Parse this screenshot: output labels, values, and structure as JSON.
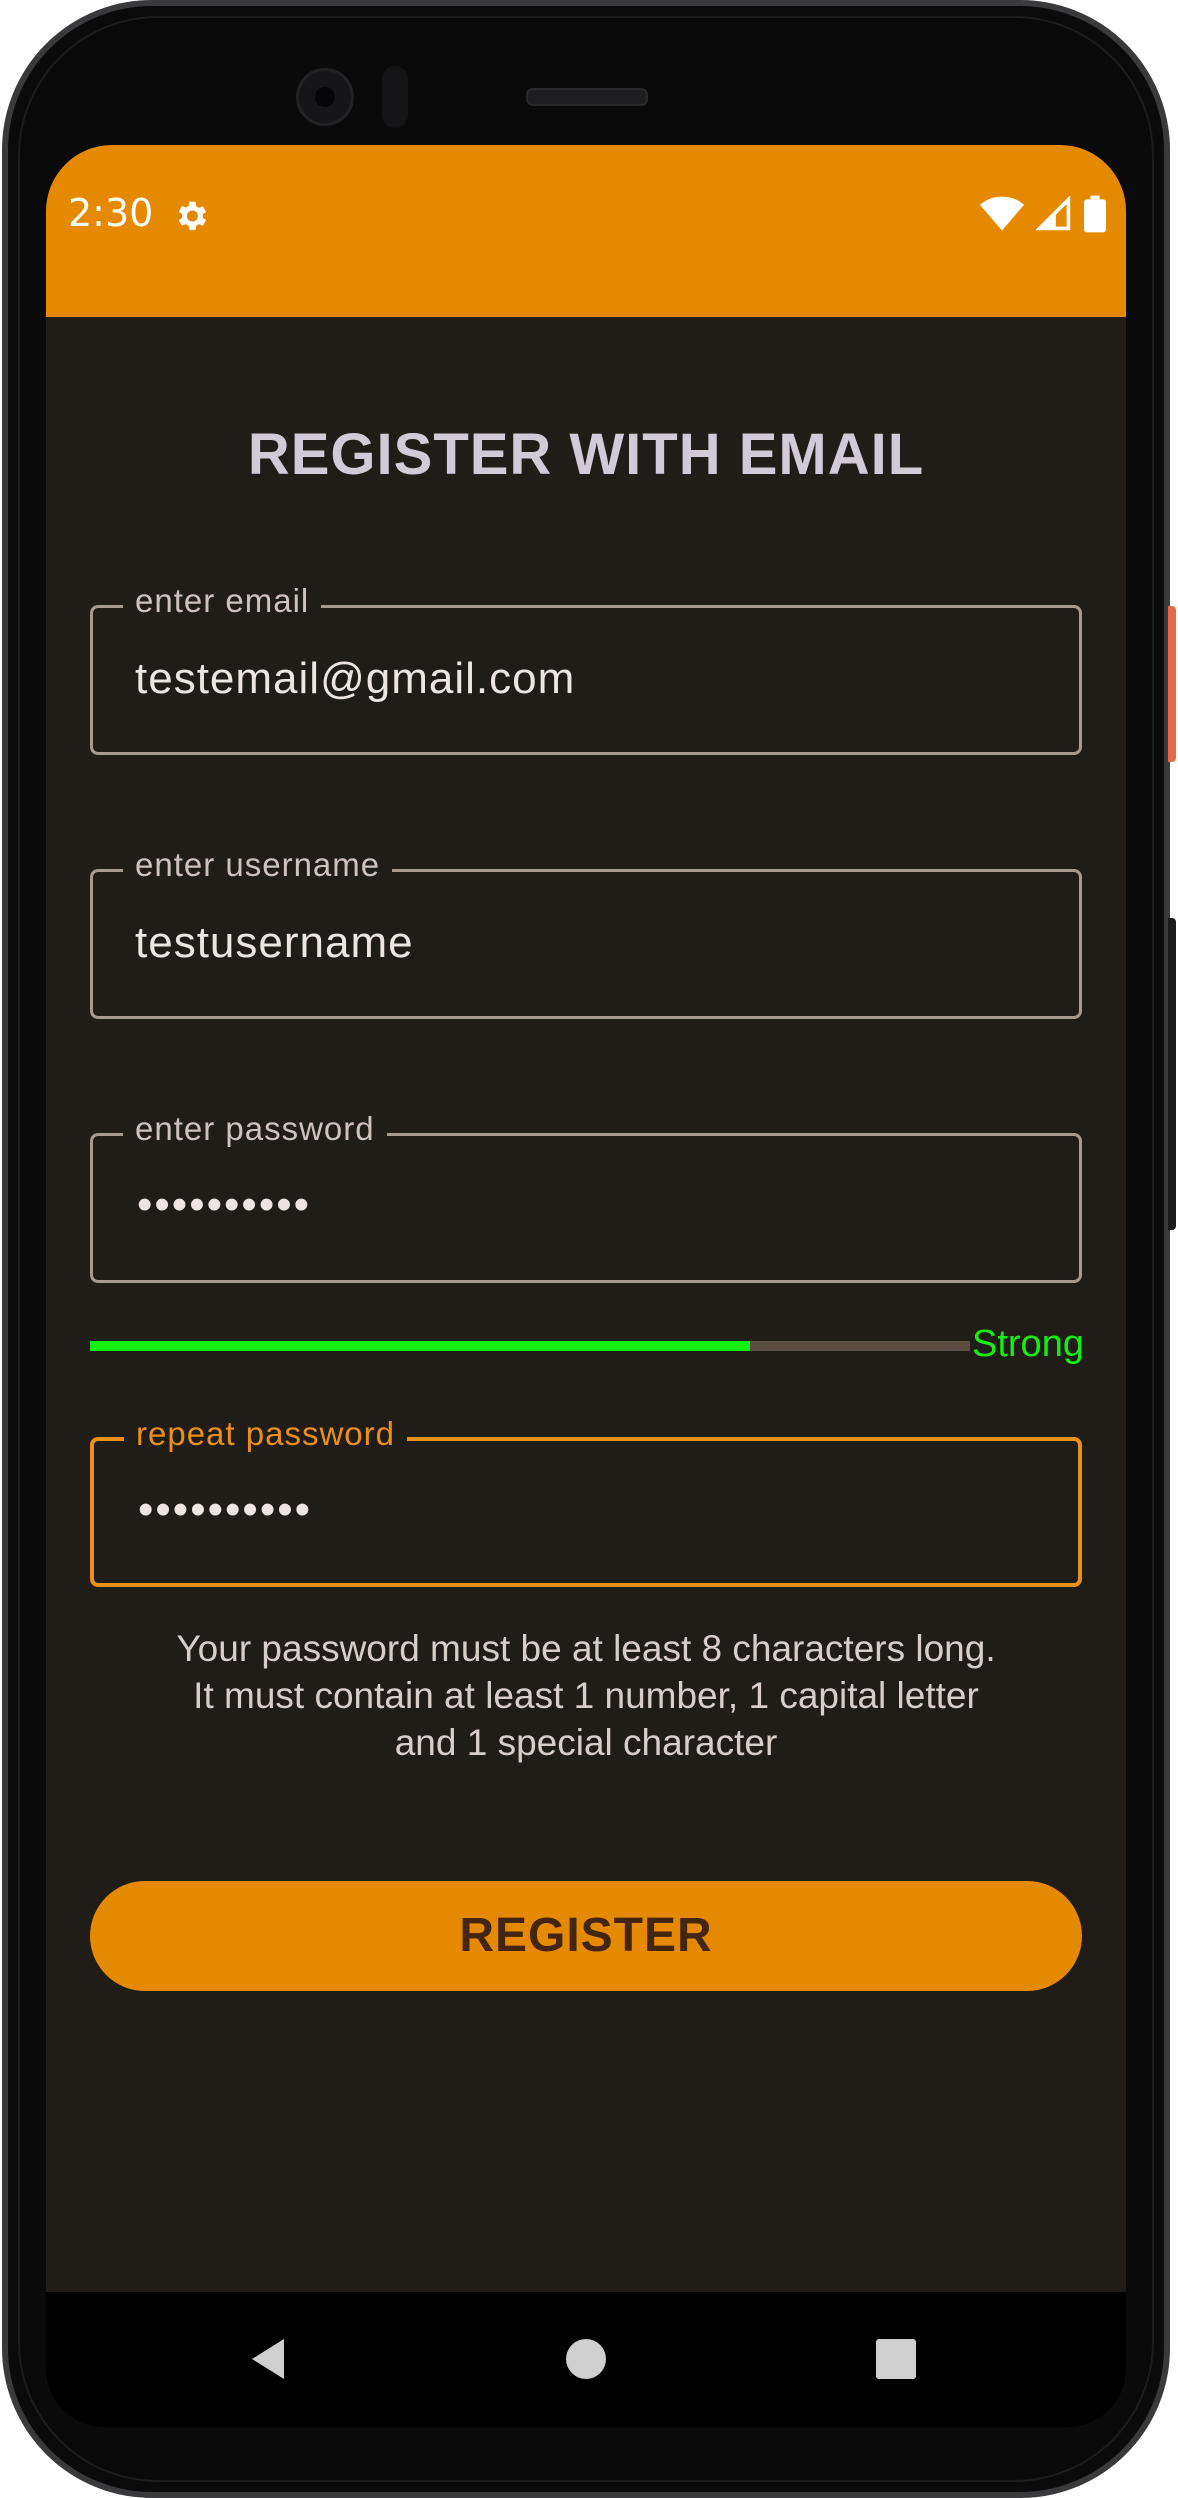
{
  "status_bar": {
    "time": "2:30",
    "icons": [
      "gear-icon",
      "wifi-icon",
      "cell-signal-icon",
      "battery-icon"
    ]
  },
  "page": {
    "title": "REGISTER WITH EMAIL"
  },
  "form": {
    "email": {
      "label": "enter email",
      "value": "testemail@gmail.com"
    },
    "username": {
      "label": "enter username",
      "value": "testusername"
    },
    "password": {
      "label": "enter password",
      "masked_value": "••••••••••"
    },
    "password_strength": {
      "label": "Strong",
      "level": 0.75
    },
    "repeat_password": {
      "label": "repeat password",
      "masked_value": "••••••••••"
    },
    "hint_lines": [
      "Your password must be at least 8 characters long.",
      "It must contain at least 1 number, 1 capital letter",
      "and 1 special character"
    ],
    "register_label": "REGISTER"
  },
  "nav_bar": {
    "icons": [
      "back-icon",
      "home-icon",
      "recents-icon"
    ]
  },
  "colors": {
    "accent": "#e58a00",
    "background": "#201d19",
    "strength_good": "#14ee10",
    "focus_outline": "#e8901c"
  }
}
